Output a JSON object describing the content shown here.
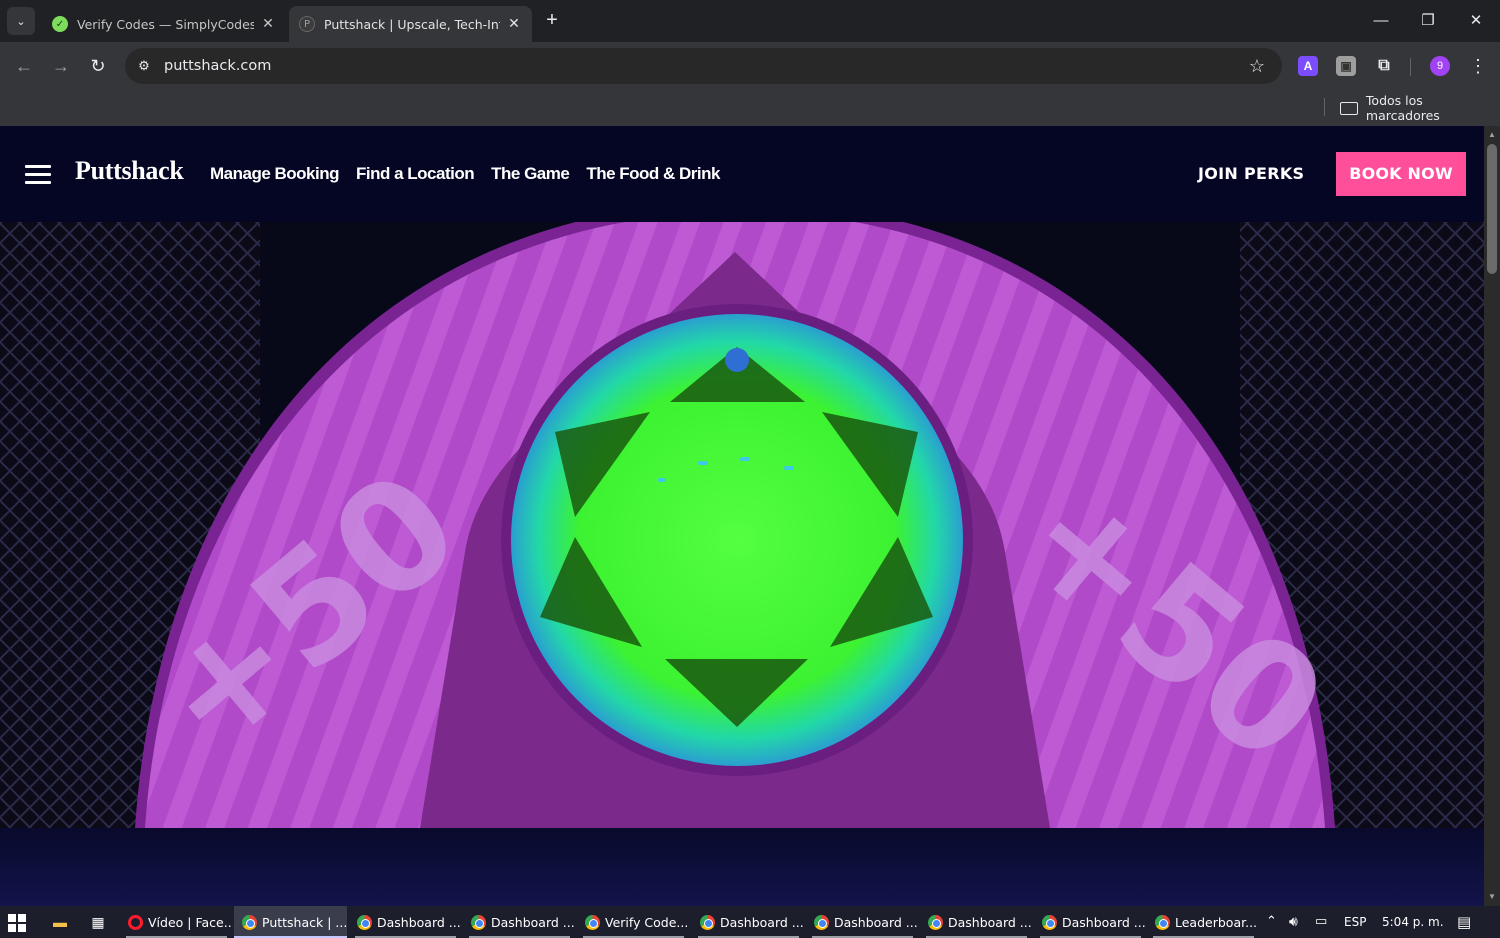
{
  "browser": {
    "tabs": [
      {
        "title": "Verify Codes — SimplyCodes",
        "active": false,
        "favicon": "simplycodes-check-icon"
      },
      {
        "title": "Puttshack | Upscale, Tech-Infused",
        "active": true,
        "favicon": "puttshack-p-icon"
      }
    ],
    "url": "puttshack.com",
    "bookmarks_all": "Todos los marcadores",
    "profile_initial": "9",
    "extension_letter": "A"
  },
  "site": {
    "logo": "Puttshack",
    "nav": [
      "Manage Booking",
      "Find a Location",
      "The Game",
      "The Food & Drink"
    ],
    "join_label": "JOIN PERKS",
    "book_label": "BOOK NOW",
    "accent": "#ff4f9a",
    "hero": {
      "left_score": "+50",
      "right_score": "+50",
      "colors": {
        "ring": "#b24fc9",
        "center": "#4cff38",
        "bg": "#070818"
      }
    }
  },
  "taskbar": {
    "apps": [
      {
        "label": "Vídeo | Face...",
        "icon": "opera-icon",
        "active": false
      },
      {
        "label": "Puttshack | ...",
        "icon": "chrome-icon",
        "active": true
      },
      {
        "label": "Dashboard ...",
        "icon": "chrome-icon",
        "active": false
      },
      {
        "label": "Dashboard ...",
        "icon": "chrome-icon",
        "active": false
      },
      {
        "label": "Verify Code...",
        "icon": "chrome-icon",
        "active": false
      },
      {
        "label": "Dashboard ...",
        "icon": "chrome-icon",
        "active": false
      },
      {
        "label": "Dashboard ...",
        "icon": "chrome-icon",
        "active": false
      },
      {
        "label": "Dashboard ...",
        "icon": "chrome-icon",
        "active": false
      },
      {
        "label": "Dashboard ...",
        "icon": "chrome-icon",
        "active": false
      },
      {
        "label": "Leaderboar...",
        "icon": "chrome-icon",
        "active": false
      }
    ],
    "language": "ESP",
    "time": "5:04 p. m."
  }
}
